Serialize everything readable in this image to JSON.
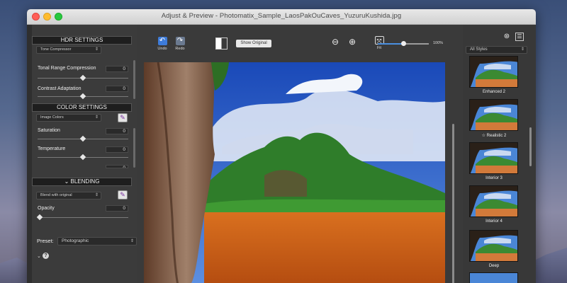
{
  "window": {
    "title": "Adjust & Preview - Photomatix_Sample_LaosPakOuCaves_YuzuruKushida.jpg"
  },
  "hdr": {
    "header": "HDR SETTINGS",
    "method": "Tone Compressor",
    "sliders": [
      {
        "label": "Tonal Range Compression",
        "value": "0",
        "position": 0.5
      },
      {
        "label": "Contrast Adaptation",
        "value": "0",
        "position": 0.5
      }
    ]
  },
  "color": {
    "header": "COLOR SETTINGS",
    "mode": "Image Colors",
    "sliders": [
      {
        "label": "Saturation",
        "value": "0",
        "position": 0.5
      },
      {
        "label": "Temperature",
        "value": "0",
        "position": 0.5
      },
      {
        "label": "",
        "value": "0"
      }
    ]
  },
  "blending": {
    "header": "BLENDING",
    "mode": "Blend with original",
    "sliders": [
      {
        "label": "Opacity",
        "value": "0",
        "position": 0.0
      }
    ]
  },
  "preset": {
    "label": "Preset:",
    "value": "Photographic"
  },
  "toolbar": {
    "undo": "Undo",
    "redo": "Redo",
    "show_original": "Show Original",
    "fit": "Fit",
    "zoom_percent": "100%",
    "zoom_level": 0.5
  },
  "styles": {
    "filter": "All Styles",
    "items": [
      {
        "label": "Enhanced 2"
      },
      {
        "label": "Realistic 2",
        "starred": true
      },
      {
        "label": "Interior 3"
      },
      {
        "label": "Interior 4"
      },
      {
        "label": "Deep"
      }
    ]
  },
  "colors": {
    "accent": "#4a8fe0",
    "panel": "#3b3b3b",
    "header": "#1e1e1e",
    "brush": "#7a2fa0"
  }
}
